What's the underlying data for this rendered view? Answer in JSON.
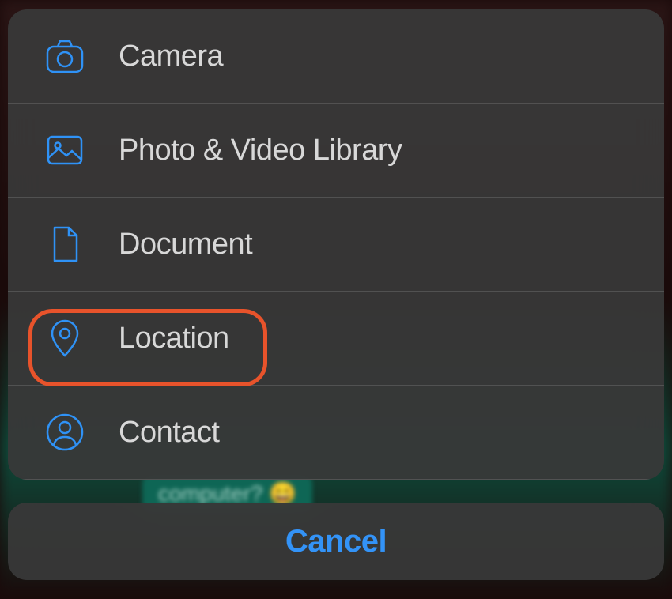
{
  "menu": {
    "items": [
      {
        "label": "Camera",
        "icon": "camera-icon"
      },
      {
        "label": "Photo & Video Library",
        "icon": "gallery-icon"
      },
      {
        "label": "Document",
        "icon": "document-icon"
      },
      {
        "label": "Location",
        "icon": "location-pin-icon",
        "highlighted": true
      },
      {
        "label": "Contact",
        "icon": "contact-icon"
      }
    ]
  },
  "cancel": {
    "label": "Cancel"
  },
  "colors": {
    "accent": "#2f92f6",
    "highlight": "#e8532b"
  },
  "background": {
    "chat_snippet": "computer? 😄"
  }
}
